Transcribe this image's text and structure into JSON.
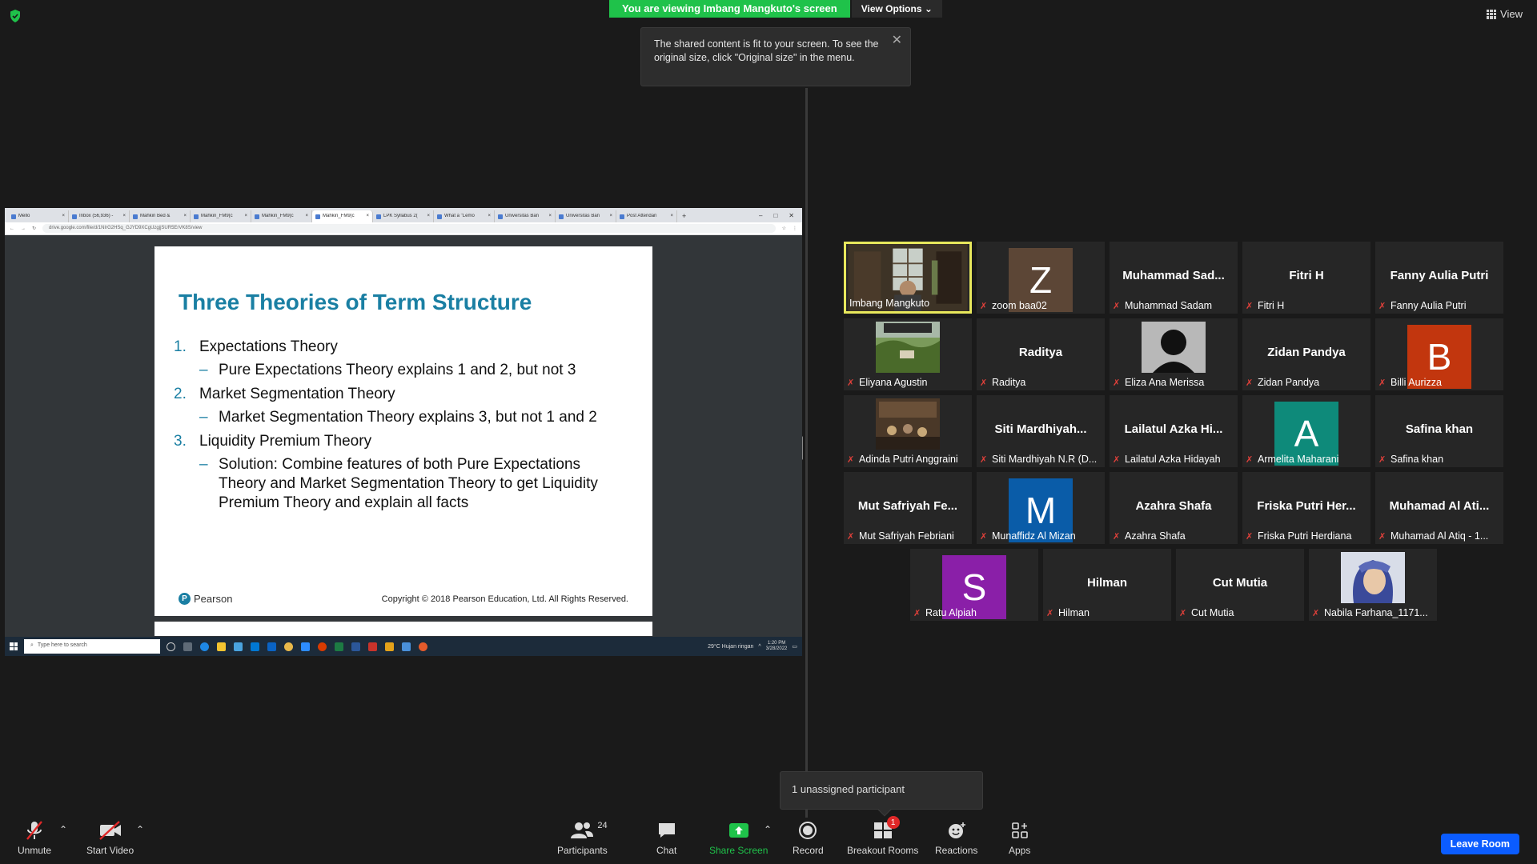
{
  "banner": {
    "viewing": "You are viewing Imbang Mangkuto's screen",
    "view_options": "View Options"
  },
  "tooltip": {
    "text": "The shared content is fit to your screen. To see the original size, click \"Original size\" in the menu."
  },
  "view_label": "View",
  "browser": {
    "tabs": [
      "Mello",
      "Inbox (56,936) -",
      "Mahkin Bed & ",
      "Mahkin_FM9(c",
      "Mahkin_FM9(c",
      "Mahkin_FM9(c",
      "LPK Syllabus 2(",
      "What a \"Lemo",
      "Universitas Ban",
      "Universitas Ban",
      "Post Attendan"
    ],
    "active_tab": 5,
    "url": "drive.google.com/file/d/1NIrG2HSq_GJYD9XCgUzgjjSUR5ErVK8S/view"
  },
  "slide": {
    "title": "Three Theories of Term Structure",
    "items": [
      {
        "num": "1.",
        "text": "Expectations Theory",
        "sub": "Pure Expectations Theory explains 1 and 2, but not 3"
      },
      {
        "num": "2.",
        "text": "Market Segmentation Theory",
        "sub": "Market Segmentation Theory explains 3, but not 1 and 2"
      },
      {
        "num": "3.",
        "text": "Liquidity Premium Theory",
        "sub": "Solution: Combine features of both Pure Expectations Theory and Market Segmentation Theory to get Liquidity Premium Theory and explain all facts"
      }
    ],
    "publisher": "Pearson",
    "copyright": "Copyright © 2018 Pearson Education, Ltd. All Rights Reserved."
  },
  "taskbar": {
    "search": "Type here to search",
    "weather": "29°C  Hujan ringan",
    "time": "1:20 PM",
    "date": "3/28/2022"
  },
  "participants": [
    {
      "label": "Imbang Mangkuto",
      "big": "",
      "avatar": "",
      "avatar_color": "",
      "photo": "video",
      "active": true
    },
    {
      "label": "zoom baa02",
      "big": "",
      "avatar": "Z",
      "avatar_color": "#5c4636",
      "photo": "",
      "active": false
    },
    {
      "label": "Muhammad Sadam",
      "big": "Muhammad  Sad...",
      "avatar": "",
      "avatar_color": "",
      "photo": "",
      "active": false
    },
    {
      "label": "Fitri H",
      "big": "Fitri H",
      "avatar": "",
      "avatar_color": "",
      "photo": "",
      "active": false
    },
    {
      "label": "Fanny Aulia Putri",
      "big": "Fanny Aulia Putri",
      "avatar": "",
      "avatar_color": "",
      "photo": "",
      "active": false
    },
    {
      "label": "Eliyana Agustin",
      "big": "",
      "avatar": "",
      "avatar_color": "",
      "photo": "landscape",
      "active": false
    },
    {
      "label": "Raditya",
      "big": "Raditya",
      "avatar": "",
      "avatar_color": "",
      "photo": "",
      "active": false
    },
    {
      "label": "Eliza Ana Merissa",
      "big": "",
      "avatar": "",
      "avatar_color": "",
      "photo": "silhouette",
      "active": false
    },
    {
      "label": "Zidan Pandya",
      "big": "Zidan Pandya",
      "avatar": "",
      "avatar_color": "",
      "photo": "",
      "active": false
    },
    {
      "label": "Billi Aurizza",
      "big": "",
      "avatar": "B",
      "avatar_color": "#c2360e",
      "photo": "",
      "active": false
    },
    {
      "label": "Adinda Putri Anggraini",
      "big": "",
      "avatar": "",
      "avatar_color": "",
      "photo": "room",
      "active": false
    },
    {
      "label": "Siti Mardhiyah N.R (D...",
      "big": "Siti  Mardhiyah...",
      "avatar": "",
      "avatar_color": "",
      "photo": "",
      "active": false
    },
    {
      "label": "Lailatul Azka Hidayah",
      "big": "Lailatul  Azka  Hi...",
      "avatar": "",
      "avatar_color": "",
      "photo": "",
      "active": false
    },
    {
      "label": "Armelita Maharani",
      "big": "",
      "avatar": "A",
      "avatar_color": "#0e8a7a",
      "photo": "",
      "active": false
    },
    {
      "label": "Safina khan",
      "big": "Safina khan",
      "avatar": "",
      "avatar_color": "",
      "photo": "",
      "active": false
    },
    {
      "label": "Mut Safriyah Febriani",
      "big": "Mut  Safriyah  Fe...",
      "avatar": "",
      "avatar_color": "",
      "photo": "",
      "active": false
    },
    {
      "label": "Munaffidz Al Mizan",
      "big": "",
      "avatar": "M",
      "avatar_color": "#0a5ca8",
      "photo": "",
      "active": false
    },
    {
      "label": "Azahra Shafa",
      "big": "Azahra Shafa",
      "avatar": "",
      "avatar_color": "",
      "photo": "",
      "active": false
    },
    {
      "label": "Friska Putri Herdiana",
      "big": "Friska  Putri  Her...",
      "avatar": "",
      "avatar_color": "",
      "photo": "",
      "active": false
    },
    {
      "label": "Muhamad Al Atiq - 1...",
      "big": "Muhamad  Al  Ati...",
      "avatar": "",
      "avatar_color": "",
      "photo": "",
      "active": false
    },
    {
      "label": "Ratu Alpiah",
      "big": "",
      "avatar": "S",
      "avatar_color": "#8a1fa8",
      "photo": "",
      "active": false
    },
    {
      "label": "Hilman",
      "big": "Hilman",
      "avatar": "",
      "avatar_color": "",
      "photo": "",
      "active": false
    },
    {
      "label": "Cut Mutia",
      "big": "Cut Mutia",
      "avatar": "",
      "avatar_color": "",
      "photo": "",
      "active": false
    },
    {
      "label": "Nabila Farhana_1171...",
      "big": "",
      "avatar": "",
      "avatar_color": "",
      "photo": "hijab",
      "active": false
    }
  ],
  "toast": {
    "text": "1 unassigned participant"
  },
  "toolbar": {
    "unmute": "Unmute",
    "start_video": "Start Video",
    "participants": "Participants",
    "participants_count": "24",
    "chat": "Chat",
    "share_screen": "Share Screen",
    "record": "Record",
    "breakout_rooms": "Breakout Rooms",
    "breakout_badge": "1",
    "reactions": "Reactions",
    "apps": "Apps",
    "leave": "Leave Room"
  },
  "colors": {
    "accent_green": "#1fc24a",
    "active_speaker": "#e8e85c",
    "leave_blue": "#0b5cff",
    "slide_blue": "#1a7fa3"
  }
}
